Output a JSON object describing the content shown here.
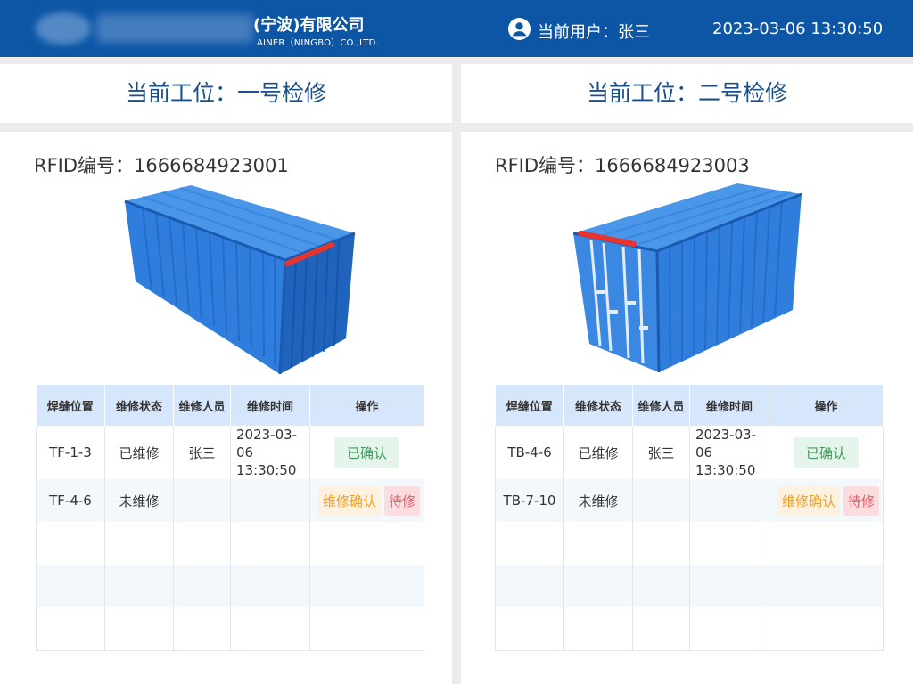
{
  "header": {
    "company_cn": "(宁波)有限公司",
    "company_en": "AINER（NINGBO）CO.,LTD.",
    "user_label": "当前用户：张三",
    "datetime": "2023-03-06 13:30:50",
    "colors": {
      "bar": "#0d56a6"
    }
  },
  "stations": [
    {
      "title": "当前工位：一号检修",
      "rfid": "RFID编号：1666684923001",
      "table": {
        "headers": [
          "焊缝位置",
          "维修状态",
          "维修人员",
          "维修时间",
          "操作"
        ],
        "rows": [
          {
            "position": "TF-1-3",
            "status": "已维修",
            "person": "张三",
            "time_date": "2023-03-06",
            "time_clock": "13:30:50",
            "actions": [
              "已确认"
            ]
          },
          {
            "position": "TF-4-6",
            "status": "未维修",
            "person": "",
            "time_date": "",
            "time_clock": "",
            "actions": [
              "维修确认",
              "待修"
            ]
          }
        ]
      }
    },
    {
      "title": "当前工位：二号检修",
      "rfid": "RFID编号：1666684923003",
      "table": {
        "headers": [
          "焊缝位置",
          "维修状态",
          "维修人员",
          "维修时间",
          "操作"
        ],
        "rows": [
          {
            "position": "TB-4-6",
            "status": "已维修",
            "person": "张三",
            "time_date": "2023-03-06",
            "time_clock": "13:30:50",
            "actions": [
              "已确认"
            ]
          },
          {
            "position": "TB-7-10",
            "status": "未维修",
            "person": "",
            "time_date": "",
            "time_clock": "",
            "actions": [
              "维修确认",
              "待修"
            ]
          }
        ]
      }
    }
  ],
  "icons": {
    "user": "user-circle-icon"
  },
  "colors": {
    "status_done": "#3d9a5c",
    "weld_mark": "#e8332f",
    "container": "#2f7ddc"
  }
}
